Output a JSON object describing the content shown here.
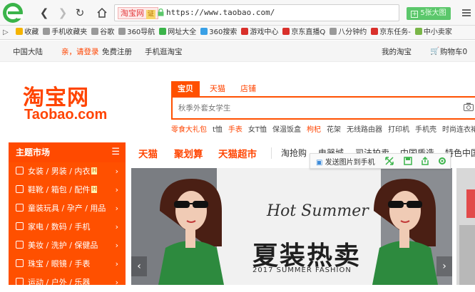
{
  "browser": {
    "address": {
      "site_label": "淘宝网",
      "site_badge": "证",
      "url": "https://www.taobao.com/"
    },
    "big_image_button": "5张大图"
  },
  "bookmarks": [
    {
      "label": "收藏",
      "icon": "star-icon",
      "color": "#f5b400"
    },
    {
      "label": "手机收藏夹",
      "icon": "doc-icon",
      "color": "#999999"
    },
    {
      "label": "谷歌",
      "icon": "doc-icon",
      "color": "#999999"
    },
    {
      "label": "360导航",
      "icon": "doc-icon",
      "color": "#999999"
    },
    {
      "label": "网址大全",
      "icon": "site-icon",
      "color": "#3bb44a"
    },
    {
      "label": "360搜索",
      "icon": "search360-icon",
      "color": "#39a0e6"
    },
    {
      "label": "游戏中心",
      "icon": "game-icon",
      "color": "#d9302b"
    },
    {
      "label": "京东直播Q",
      "icon": "jd-icon",
      "color": "#d9302b"
    },
    {
      "label": "八分钟约",
      "icon": "doc-icon",
      "color": "#999999"
    },
    {
      "label": "京东任务-",
      "icon": "jd-icon",
      "color": "#d9302b"
    },
    {
      "label": "中小卖家",
      "icon": "store-icon",
      "color": "#7ab648"
    }
  ],
  "site_nav": {
    "region": "中国大陆",
    "greeting": "亲，请登录",
    "register": "免费注册",
    "mobile": "手机逛淘宝",
    "my_taobao": "我的淘宝",
    "cart": "购物车0"
  },
  "logo": {
    "cn": "淘宝网",
    "en": "Taobao.com"
  },
  "search": {
    "tabs": [
      "宝贝",
      "天猫",
      "店铺"
    ],
    "placeholder": "秋季外套女学生",
    "hot_words": [
      {
        "text": "零食大礼包",
        "hot": true
      },
      {
        "text": "t恤",
        "hot": false
      },
      {
        "text": "手表",
        "hot": true
      },
      {
        "text": "女T恤",
        "hot": false
      },
      {
        "text": "保温饭盒",
        "hot": false
      },
      {
        "text": "枸杞",
        "hot": true
      },
      {
        "text": "花架",
        "hot": false
      },
      {
        "text": "无线路由器",
        "hot": false
      },
      {
        "text": "打印机",
        "hot": false
      },
      {
        "text": "手机壳",
        "hot": false
      },
      {
        "text": "时尚连衣裙",
        "hot": false
      }
    ]
  },
  "categories": {
    "title": "主题市场",
    "items": [
      {
        "label": "女装 / 男装 / 内衣",
        "hot": true
      },
      {
        "label": "鞋靴 / 箱包 / 配件",
        "hot": true
      },
      {
        "label": "童装玩具 / 孕产 / 用品",
        "hot": false
      },
      {
        "label": "家电 / 数码 / 手机",
        "hot": false
      },
      {
        "label": "美妆 / 洗护 / 保健品",
        "hot": false
      },
      {
        "label": "珠宝 / 眼镜 / 手表",
        "hot": false
      },
      {
        "label": "运动 / 户外 / 乐器",
        "hot": false
      }
    ],
    "hot_badge": "H"
  },
  "main_nav": {
    "big": [
      "天猫",
      "聚划算",
      "天猫超市"
    ],
    "small": [
      "淘抢购",
      "电器城",
      "司法拍卖",
      "中国质造",
      "特色中国"
    ]
  },
  "image_tools": {
    "send_label": "发送图片到手机"
  },
  "banner": {
    "script": "Hot Summer",
    "title": "夏装热卖",
    "subtitle": "2017 SUMMER FASHION"
  },
  "colors": {
    "brand": "#ff5000",
    "address_green": "#5bc76b"
  }
}
